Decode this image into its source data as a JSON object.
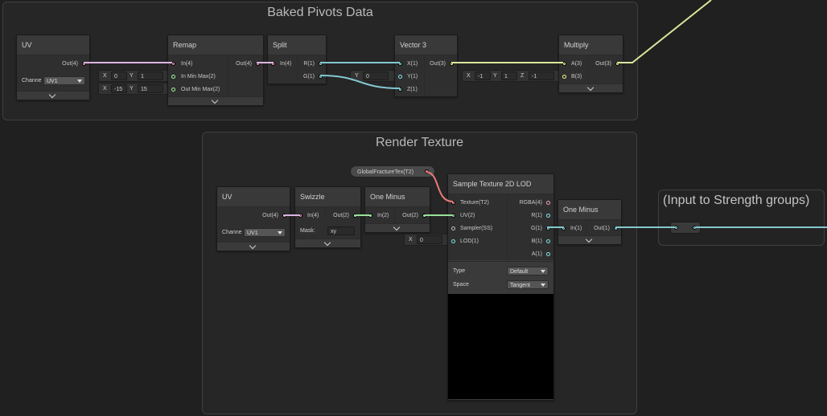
{
  "groups": {
    "baked_pivots": {
      "title": "Baked Pivots Data"
    },
    "render_texture": {
      "title": "Render Texture"
    }
  },
  "sticky": {
    "title": "(Input to Strength groups)"
  },
  "colors": {
    "background": "#202020",
    "wire_vec4": "#dcb5e0",
    "wire_vec1": "#84c7cf",
    "wire_vec3": "#d8e79a",
    "wire_texture": "#e87a7a",
    "wire_vec2": "#9be09b",
    "port_vec4": "#f29cc4",
    "port_vec3": "#f5f97b",
    "port_vec2": "#9ff5a0",
    "port_vec1": "#84e4e7",
    "port_texture": "#ff8b8b"
  },
  "nodes": {
    "uv1": {
      "title": "UV",
      "out": "Out(4)",
      "channel_label": "Channe",
      "channel_value": "UV1"
    },
    "remap": {
      "title": "Remap",
      "in": "In(4)",
      "in_min_max": "In Min Max(2)",
      "out_min_max": "Out Min Max(2)",
      "out": "Out(4)",
      "in_min": {
        "x_label": "X",
        "x": "0",
        "y_label": "Y",
        "y": "1"
      },
      "out_min": {
        "x_label": "X",
        "x": "-15",
        "y_label": "Y",
        "y": "15"
      }
    },
    "split": {
      "title": "Split",
      "in": "In(4)",
      "r": "R(1)",
      "g": "G(1)"
    },
    "vector3": {
      "title": "Vector 3",
      "x": "X(1)",
      "y": "Y(1)",
      "z": "Z(1)",
      "out": "Out(3)",
      "y_inline": {
        "label": "Y",
        "value": "0"
      }
    },
    "multiply": {
      "title": "Multiply",
      "a": "A(3)",
      "b": "B(3)",
      "out": "Out(3)",
      "b_inline": {
        "x_label": "X",
        "x": "-1",
        "y_label": "Y",
        "y": "1",
        "z_label": "Z",
        "z": "-1"
      }
    },
    "uv2": {
      "title": "UV",
      "out": "Out(4)",
      "channel_label": "Channe",
      "channel_value": "UV1"
    },
    "swizzle": {
      "title": "Swizzle",
      "in": "In(4)",
      "out": "Out(2)",
      "mask_label": "Mask:",
      "mask_value": "xy"
    },
    "one_minus1": {
      "title": "One Minus",
      "in": "In(2)",
      "out": "Out(2)"
    },
    "property": {
      "label": "GlobalFractureTex(T2)"
    },
    "sample": {
      "title": "Sample Texture 2D LOD",
      "texture": "Texture(T2)",
      "uv": "UV(2)",
      "sampler": "Sampler(SS)",
      "lod": "LOD(1)",
      "rgba": "RGBA(4)",
      "r": "R(1)",
      "g": "G(1)",
      "b": "B(1)",
      "a": "A(1)",
      "type_label": "Type",
      "type_value": "Default",
      "space_label": "Space",
      "space_value": "Tangent",
      "lod_inline": {
        "label": "X",
        "value": "0"
      }
    },
    "one_minus2": {
      "title": "One Minus",
      "in": "In(1)",
      "out": "Out(1)"
    }
  }
}
